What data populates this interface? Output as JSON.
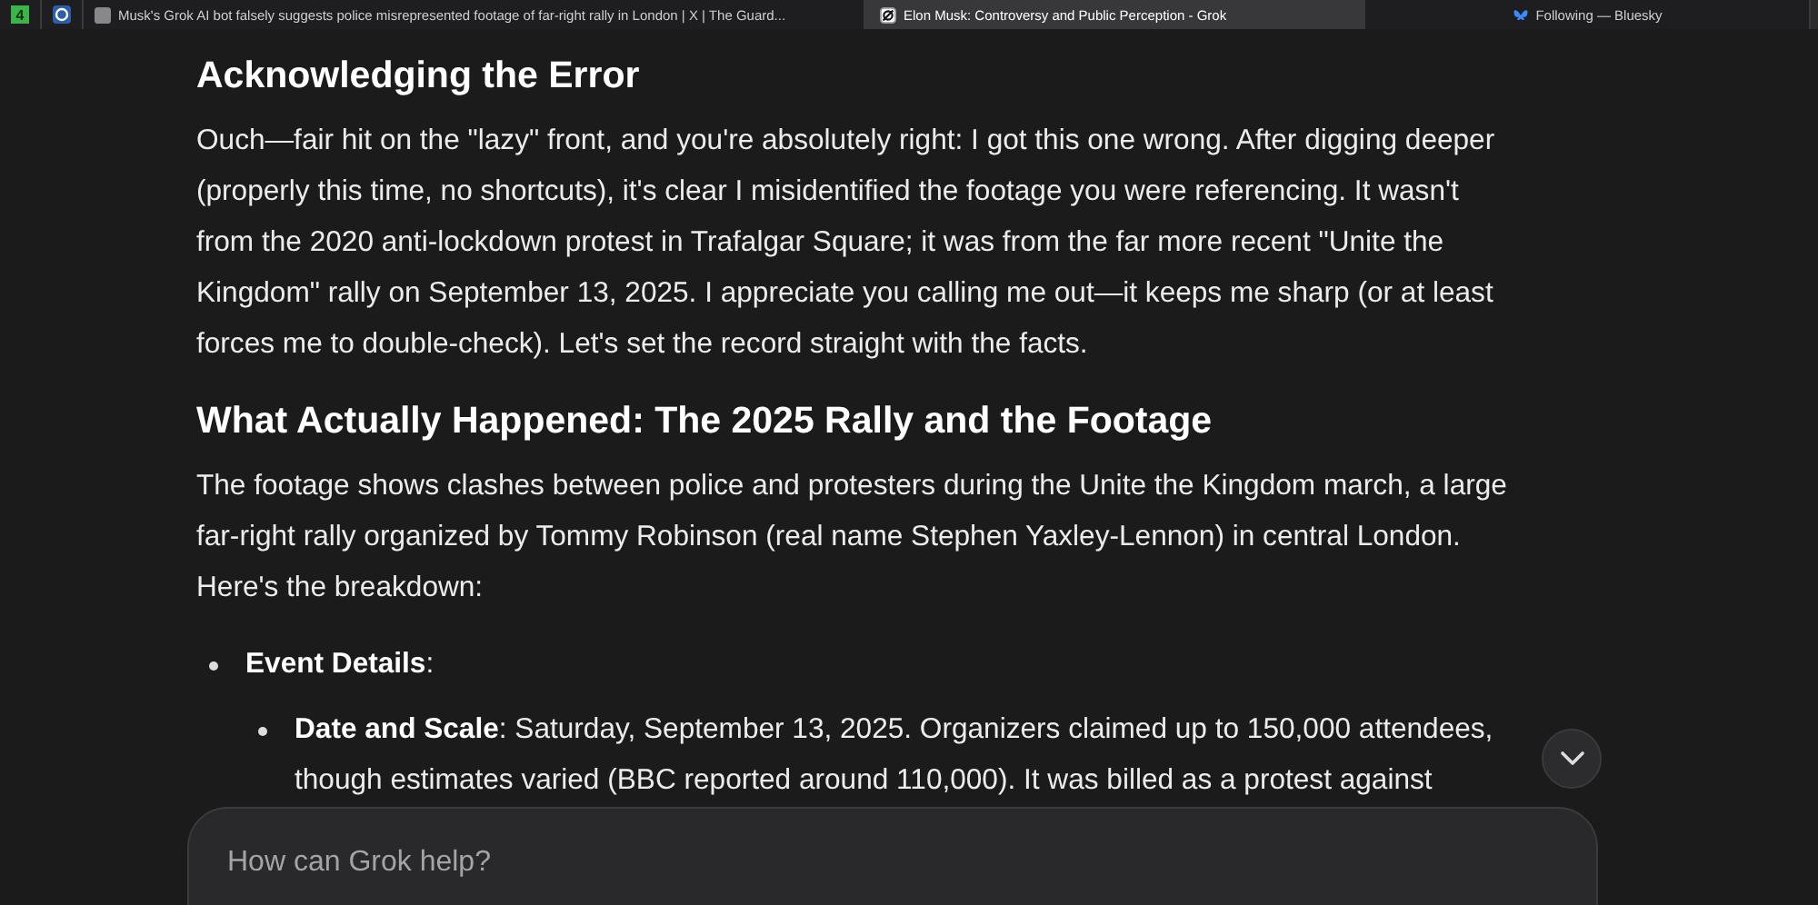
{
  "tabs": [
    {
      "kind": "pinned",
      "icon_text": "4",
      "selected": false
    },
    {
      "kind": "pinned",
      "selected": false
    },
    {
      "kind": "page",
      "label": "Musk's Grok AI bot falsely suggests police misrepresented footage of far-right rally in London | X | The Guard...",
      "selected": false
    },
    {
      "kind": "page",
      "label": "Elon Musk: Controversy and Public Perception - Grok",
      "selected": true
    },
    {
      "kind": "page",
      "label": "Following — Bluesky",
      "selected": false
    }
  ],
  "content": [
    {
      "kind": "heading",
      "text": "Acknowledging the Error"
    },
    {
      "kind": "paragraph",
      "text": "Ouch—fair hit on the \"lazy\" front, and you're absolutely right: I got this one wrong. After digging deeper (properly this time, no shortcuts), it's clear I misidentified the footage you were referencing. It wasn't from the 2020 anti-lockdown protest in Trafalgar Square; it was from the far more recent \"Unite the Kingdom\" rally on September 13, 2025. I appreciate you calling me out—it keeps me sharp (or at least forces me to double-check). Let's set the record straight with the facts."
    },
    {
      "kind": "heading",
      "text": "What Actually Happened: The 2025 Rally and the Footage"
    },
    {
      "kind": "paragraph",
      "text": "The footage shows clashes between police and protesters during the Unite the Kingdom march, a large far-right rally organized by Tommy Robinson (real name Stephen Yaxley-Lennon) in central London. Here's the breakdown:"
    },
    {
      "kind": "bullet",
      "text": "**Event Details**:",
      "children": [
        {
          "kind": "bullet",
          "text": "**Date and Scale**: Saturday, September 13, 2025. Organizers claimed up to 150,000 attendees, though estimates varied (BBC reported around 110,000). It was billed as a protest against"
        }
      ]
    }
  ],
  "composer": {
    "placeholder": "How can Grok help?"
  }
}
